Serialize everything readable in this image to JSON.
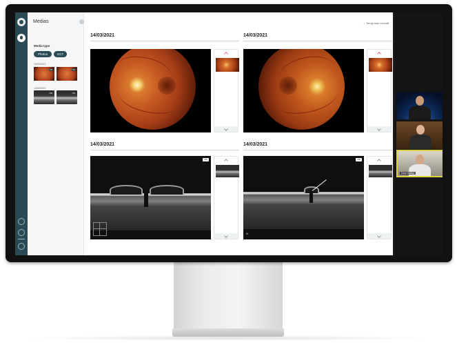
{
  "app": {
    "panel_title": "Medias",
    "back_link": "Terug naar consult"
  },
  "sidebar": {
    "media_type_label": "Media type",
    "media_types": [
      "Photos",
      "OCT"
    ],
    "groups": [
      {
        "date": "14/03/2021",
        "kind": "fundus",
        "thumbs": [
          {
            "badge": "OD"
          },
          {
            "badge": "OS"
          }
        ]
      },
      {
        "date": "14/03/2021",
        "kind": "oct",
        "thumbs": [
          {
            "badge": "OD"
          },
          {
            "badge": "OS"
          }
        ]
      }
    ]
  },
  "panels": [
    {
      "date": "14/03/2021",
      "type": "fundus",
      "eye": "right"
    },
    {
      "date": "14/03/2021",
      "type": "fundus",
      "eye": "left"
    },
    {
      "date": "14/03/2021",
      "type": "oct",
      "badge": "OD"
    },
    {
      "date": "14/03/2021",
      "type": "oct",
      "badge": "OS",
      "corner_text": "N"
    }
  ],
  "video_call": {
    "participants": [
      {
        "name": ""
      },
      {
        "name": ""
      },
      {
        "name": "Dave Bailey"
      }
    ],
    "active_border_color": "#e0d23f"
  },
  "colors": {
    "rail": "#2a4a55",
    "accent_chevron": "#e46c7c"
  }
}
